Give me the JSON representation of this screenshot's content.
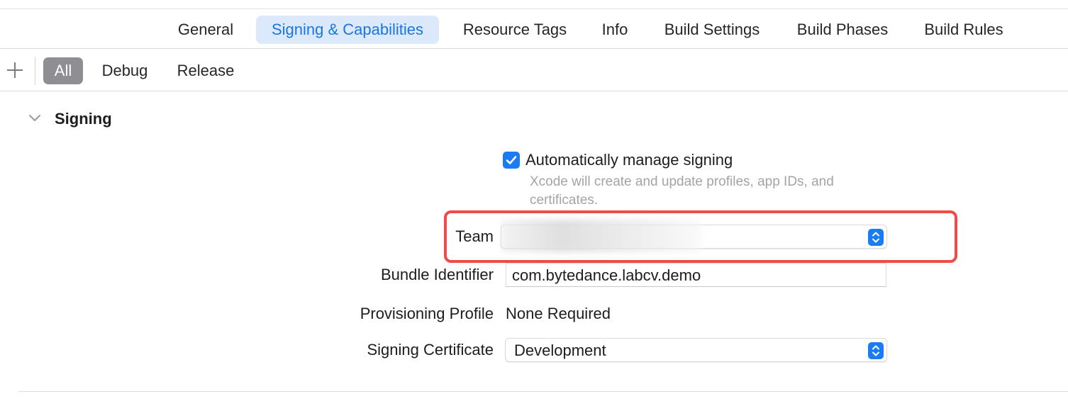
{
  "tabs": [
    {
      "label": "General",
      "active": false
    },
    {
      "label": "Signing & Capabilities",
      "active": true
    },
    {
      "label": "Resource Tags",
      "active": false
    },
    {
      "label": "Info",
      "active": false
    },
    {
      "label": "Build Settings",
      "active": false
    },
    {
      "label": "Build Phases",
      "active": false
    },
    {
      "label": "Build Rules",
      "active": false
    }
  ],
  "config_filter": {
    "add_icon": "plus-icon",
    "items": [
      {
        "label": "All",
        "active": true
      },
      {
        "label": "Debug",
        "active": false
      },
      {
        "label": "Release",
        "active": false
      }
    ]
  },
  "signing": {
    "section_title": "Signing",
    "auto_manage": {
      "label": "Automatically manage signing",
      "checked": true,
      "description": "Xcode will create and update profiles, app IDs, and certificates."
    },
    "team": {
      "label": "Team",
      "value": ""
    },
    "bundle_identifier": {
      "label": "Bundle Identifier",
      "value": "com.bytedance.labcv.demo"
    },
    "provisioning_profile": {
      "label": "Provisioning Profile",
      "value": "None Required"
    },
    "signing_certificate": {
      "label": "Signing Certificate",
      "value": "Development"
    }
  },
  "colors": {
    "accent": "#1a7bf2",
    "selected_tab_bg": "#dbe9fb",
    "highlight_border": "#ef4b4b"
  }
}
